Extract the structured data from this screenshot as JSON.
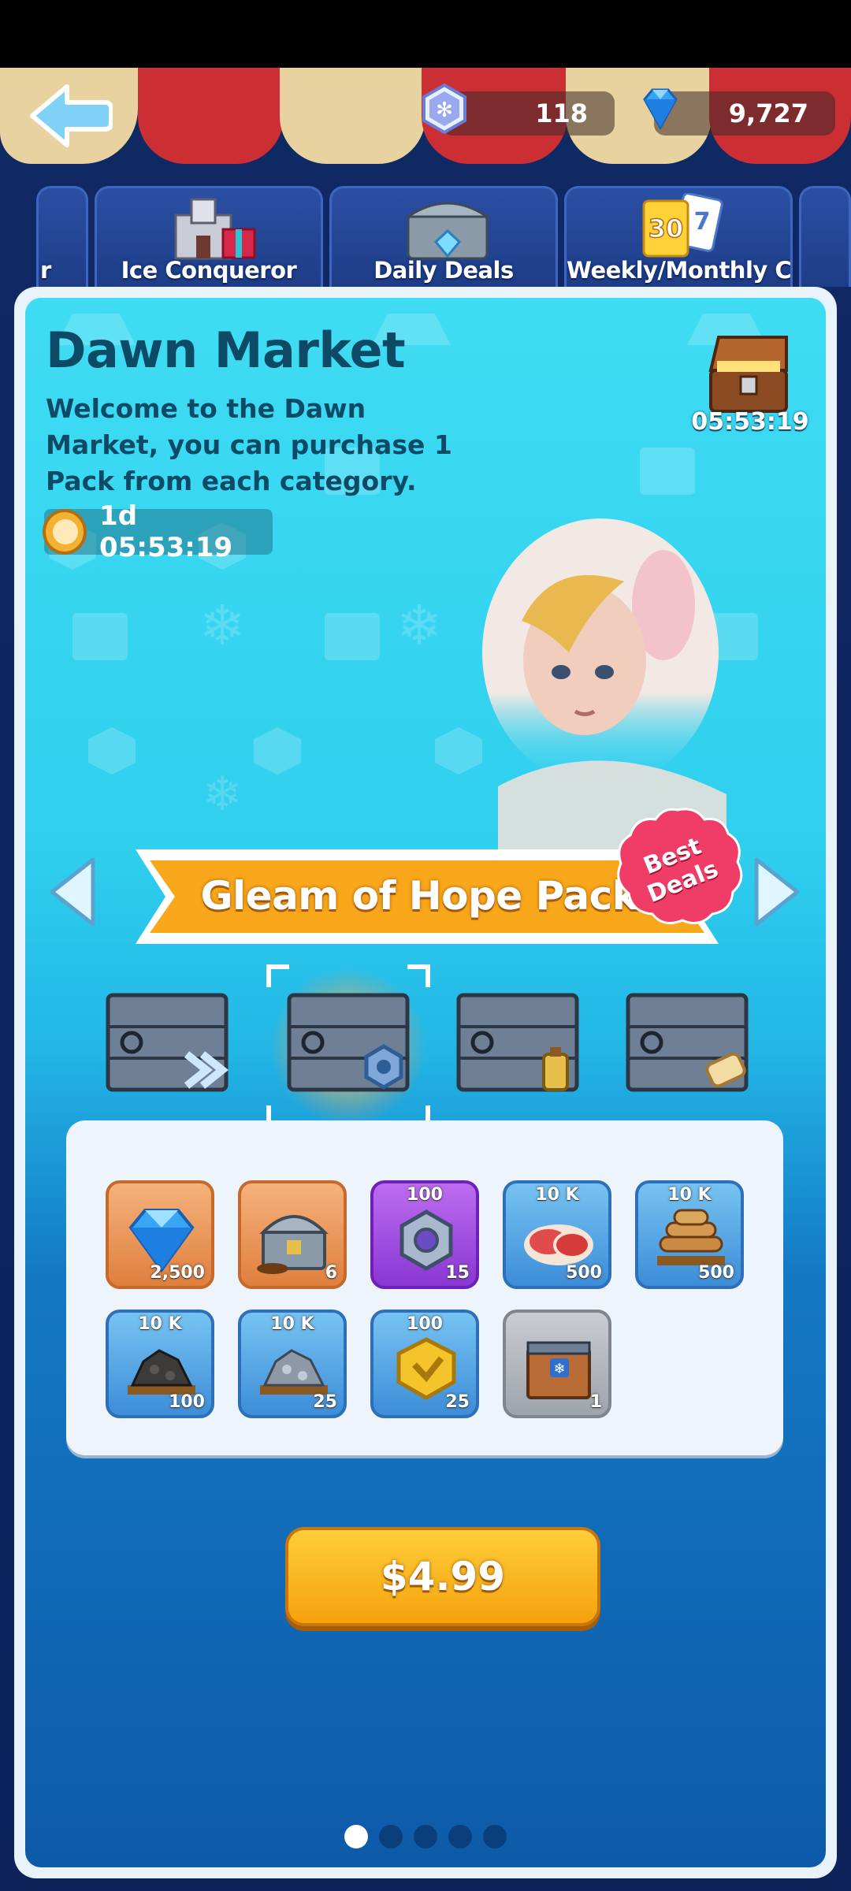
{
  "currencies": [
    {
      "name": "snowflake-gem",
      "value": "118"
    },
    {
      "name": "diamond",
      "value": "9,727"
    }
  ],
  "category_tabs": [
    {
      "label": "r",
      "icon": "partial-tab"
    },
    {
      "label": "Ice Conqueror",
      "icon": "castle-icon"
    },
    {
      "label": "Daily Deals",
      "icon": "chest-icon"
    },
    {
      "label": "Weekly/Monthly Cards",
      "icon": "cards-icon",
      "badge_a": "30",
      "badge_b": "7"
    }
  ],
  "market": {
    "title": "Dawn Market",
    "description": "Welcome to the Dawn Market, you can purchase 1 Pack from each category.",
    "timer": "1d 05:53:19",
    "chest_timer": "05:53:19"
  },
  "pack": {
    "name": "Gleam of Hope Pack",
    "badge": "Best Deals",
    "selected_index": 1
  },
  "items": [
    {
      "icon": "diamond-icon",
      "rarity": "orange",
      "top": "",
      "count": "2,500"
    },
    {
      "icon": "chest-icon",
      "rarity": "orange",
      "top": "",
      "count": "6"
    },
    {
      "icon": "gear-nut-icon",
      "rarity": "purple",
      "top": "100",
      "count": "15"
    },
    {
      "icon": "meat-icon",
      "rarity": "blue",
      "top": "10 K",
      "count": "500"
    },
    {
      "icon": "wood-icon",
      "rarity": "blue",
      "top": "10 K",
      "count": "500"
    },
    {
      "icon": "coal-icon",
      "rarity": "blue",
      "top": "10 K",
      "count": "100"
    },
    {
      "icon": "iron-ore-icon",
      "rarity": "blue",
      "top": "10 K",
      "count": "25"
    },
    {
      "icon": "gold-token-icon",
      "rarity": "blue",
      "top": "100",
      "count": "25"
    },
    {
      "icon": "snow-crate-icon",
      "rarity": "gray",
      "top": "",
      "count": "1"
    }
  ],
  "buy": {
    "price": "$4.99"
  },
  "pagination": {
    "count": 5,
    "active": 0
  }
}
